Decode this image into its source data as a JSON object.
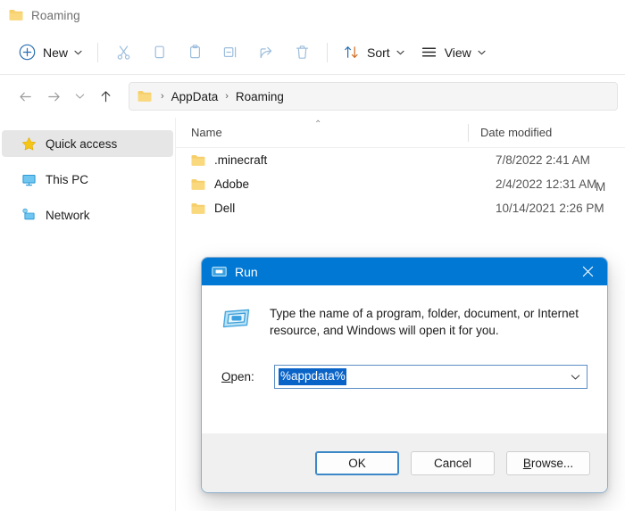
{
  "window": {
    "title": "Roaming",
    "title_icon": "folder-icon"
  },
  "command_bar": {
    "new_label": "New",
    "new_icon": "plus-circle-icon",
    "cut_icon": "scissors-icon",
    "copy_icon": "copy-icon",
    "paste_icon": "clipboard-icon",
    "rename_icon": "rename-icon",
    "share_icon": "share-icon",
    "delete_icon": "trash-icon",
    "sort_label": "Sort",
    "sort_icon": "sort-arrows-icon",
    "view_label": "View",
    "view_icon": "hamburger-lines-icon",
    "chevron": "⌄"
  },
  "nav": {
    "back_icon": "arrow-left-icon",
    "forward_icon": "arrow-right-icon",
    "recent_icon": "chevron-down-icon",
    "up_icon": "arrow-up-icon",
    "address_icon": "folder-icon",
    "breadcrumbs": [
      "AppData",
      "Roaming"
    ],
    "separator": "›"
  },
  "sidebar": {
    "items": [
      {
        "label": "Quick access",
        "icon": "star-icon",
        "selected": true
      },
      {
        "label": "This PC",
        "icon": "monitor-icon",
        "selected": false
      },
      {
        "label": "Network",
        "icon": "network-icon",
        "selected": false
      }
    ]
  },
  "file_list": {
    "columns": {
      "name": "Name",
      "date_modified": "Date modified"
    },
    "sort_indicator": "⌃",
    "rows": [
      {
        "name": ".minecraft",
        "date": "7/8/2022 2:41 AM",
        "icon": "folder-icon"
      },
      {
        "name": "Adobe",
        "date": "2/4/2022 12:31 AM",
        "icon": "folder-icon"
      },
      {
        "name": "Dell",
        "date": "10/14/2021 2:26 PM",
        "icon": "folder-icon"
      }
    ],
    "occluded_row_fragment": "M"
  },
  "run_dialog": {
    "title": "Run",
    "title_icon": "run-icon",
    "close_icon": "close-icon",
    "body_icon": "run-icon-large",
    "description": "Type the name of a program, folder, document, or Internet resource, and Windows will open it for you.",
    "open_label_prefix": "O",
    "open_label_rest": "pen:",
    "open_value": "%appdata%",
    "dropdown_icon": "chevron-down-icon",
    "buttons": {
      "ok": "OK",
      "cancel": "Cancel",
      "browse_prefix": "B",
      "browse_rest": "rowse..."
    }
  },
  "colors": {
    "accent": "#0078d4",
    "selection": "#0a64c8",
    "folder": "#f7c948",
    "sidebar_selected": "#e6e6e6"
  }
}
